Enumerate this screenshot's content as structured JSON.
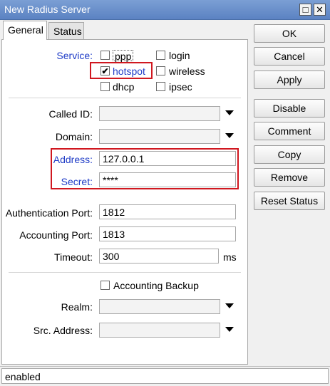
{
  "window": {
    "title": "New Radius Server"
  },
  "tabs": [
    {
      "label": "General"
    },
    {
      "label": "Status"
    }
  ],
  "service": {
    "label": "Service:",
    "options": [
      {
        "label": "ppp",
        "checked": false
      },
      {
        "label": "login",
        "checked": false
      },
      {
        "label": "hotspot",
        "checked": true
      },
      {
        "label": "wireless",
        "checked": false
      },
      {
        "label": "dhcp",
        "checked": false
      },
      {
        "label": "ipsec",
        "checked": false
      }
    ],
    "check_mark": "✔"
  },
  "fields": {
    "called_id": {
      "label": "Called ID:",
      "value": ""
    },
    "domain": {
      "label": "Domain:",
      "value": ""
    },
    "address": {
      "label": "Address:",
      "value": "127.0.0.1"
    },
    "secret": {
      "label": "Secret:",
      "value": "****"
    },
    "auth_port": {
      "label": "Authentication Port:",
      "value": "1812"
    },
    "acct_port": {
      "label": "Accounting Port:",
      "value": "1813"
    },
    "timeout": {
      "label": "Timeout:",
      "value": "300",
      "unit": "ms"
    },
    "accounting_backup": {
      "label": "Accounting Backup",
      "checked": false
    },
    "realm": {
      "label": "Realm:",
      "value": ""
    },
    "src_address": {
      "label": "Src. Address:",
      "value": ""
    }
  },
  "buttons": {
    "ok": "OK",
    "cancel": "Cancel",
    "apply": "Apply",
    "disable": "Disable",
    "comment": "Comment",
    "copy": "Copy",
    "remove": "Remove",
    "reset_status": "Reset Status"
  },
  "status": {
    "text": "enabled"
  },
  "colors": {
    "highlight_box": "#d0171f",
    "blue_label": "#1f3cc7",
    "titlebar": "#6a8fcb"
  }
}
